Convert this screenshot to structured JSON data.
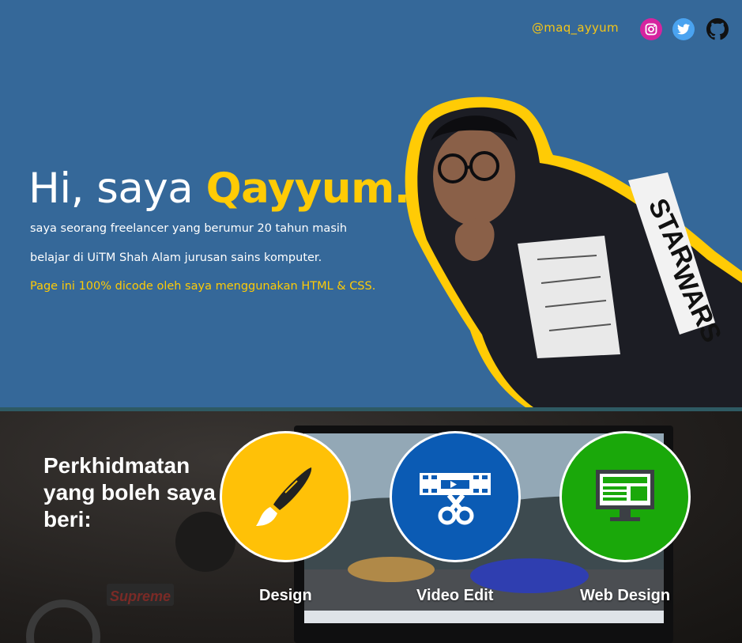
{
  "header": {
    "handle": "@maq_ayyum",
    "social": [
      {
        "name": "instagram-icon",
        "color": "#d6249f"
      },
      {
        "name": "twitter-icon",
        "color": "#4aa3f0"
      },
      {
        "name": "github-icon",
        "color": "#ffffff"
      }
    ]
  },
  "hero": {
    "greeting": "Hi, saya ",
    "name": "Qayyum.",
    "line1": "saya seorang freelancer yang berumur 20 tahun masih",
    "line2": "belajar di UiTM Shah Alam jurusan sains komputer.",
    "line3": "Page ini 100% dicode oleh saya menggunakan HTML & CSS.",
    "photo_print_top": "STAR",
    "photo_print_bottom": "WARS",
    "colors": {
      "background": "#356899",
      "accent": "#ffcb05"
    }
  },
  "services": {
    "title": "Perkhidmatan yang boleh saya beri:",
    "items": [
      {
        "label": "Design",
        "icon": "brush-icon",
        "color": "#ffc107"
      },
      {
        "label": "Video Edit",
        "icon": "video-edit-icon",
        "color": "#0b5bb4"
      },
      {
        "label": "Web Design",
        "icon": "monitor-icon",
        "color": "#1aa80a"
      }
    ],
    "background_text": "Supreme"
  }
}
